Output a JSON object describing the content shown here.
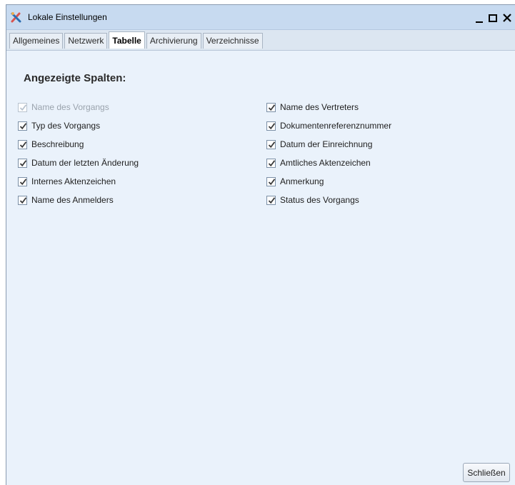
{
  "window": {
    "title": "Lokale Einstellungen",
    "icon": "tools-icon"
  },
  "tabs": [
    {
      "label": "Allgemeines",
      "active": false
    },
    {
      "label": "Netzwerk",
      "active": false
    },
    {
      "label": "Tabelle",
      "active": true
    },
    {
      "label": "Archivierung",
      "active": false
    },
    {
      "label": "Verzeichnisse",
      "active": false
    }
  ],
  "section": {
    "title": "Angezeigte Spalten:"
  },
  "columns_left": [
    {
      "label": "Name des Vorgangs",
      "checked": true,
      "disabled": true
    },
    {
      "label": "Typ des Vorgangs",
      "checked": true,
      "disabled": false
    },
    {
      "label": "Beschreibung",
      "checked": true,
      "disabled": false
    },
    {
      "label": "Datum der letzten Änderung",
      "checked": true,
      "disabled": false
    },
    {
      "label": "Internes Aktenzeichen",
      "checked": true,
      "disabled": false
    },
    {
      "label": "Name des Anmelders",
      "checked": true,
      "disabled": false
    }
  ],
  "columns_right": [
    {
      "label": "Name des Vertreters",
      "checked": true,
      "disabled": false
    },
    {
      "label": "Dokumentenreferenznummer",
      "checked": true,
      "disabled": false
    },
    {
      "label": "Datum der Einreichnung",
      "checked": true,
      "disabled": false
    },
    {
      "label": "Amtliches Aktenzeichen",
      "checked": true,
      "disabled": false
    },
    {
      "label": "Anmerkung",
      "checked": true,
      "disabled": false
    },
    {
      "label": "Status des Vorgangs",
      "checked": true,
      "disabled": false
    }
  ],
  "buttons": {
    "close_label": "Schließen"
  },
  "colors": {
    "titlebar": "#c7daf0",
    "content_bg": "#eaf2fb",
    "check_mark": "#3a3a3a",
    "disabled_text": "#9aa3ad"
  }
}
